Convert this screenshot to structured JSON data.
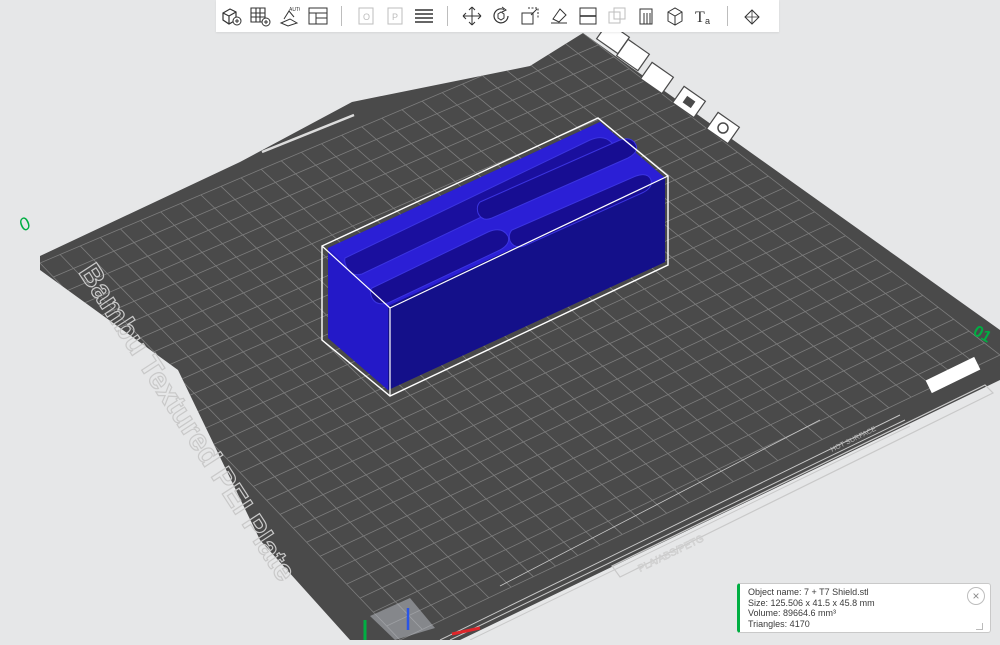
{
  "toolbar": {
    "buttons": [
      {
        "name": "add-object-icon"
      },
      {
        "name": "add-plate-icon"
      },
      {
        "name": "auto-orient-icon"
      },
      {
        "name": "arrange-icon"
      },
      {
        "name": "split-objects-icon"
      },
      {
        "name": "split-parts-icon"
      },
      {
        "name": "layers-icon"
      },
      {
        "name": "move-icon"
      },
      {
        "name": "rotate-icon"
      },
      {
        "name": "scale-icon"
      },
      {
        "name": "lay-on-face-icon"
      },
      {
        "name": "cut-icon"
      },
      {
        "name": "boolean-icon"
      },
      {
        "name": "support-paint-icon"
      },
      {
        "name": "seam-paint-icon"
      },
      {
        "name": "text-icon"
      },
      {
        "name": "measure-icon"
      }
    ]
  },
  "plate": {
    "label": "Bambu Textured PEI Plate",
    "filament_tag": "PLA/ABS/PETG",
    "hot_surface": "HOT SURFACE",
    "origin_mark": "0",
    "corner_mark": "01"
  },
  "plate_tools": [
    {
      "name": "plate-edit-icon"
    },
    {
      "name": "plate-arrange-icon"
    },
    {
      "name": "plate-orient-icon"
    },
    {
      "name": "plate-lock-icon"
    },
    {
      "name": "plate-settings-icon"
    }
  ],
  "object_info": {
    "name_line": "Object name: 7 + T7 Shield.stl",
    "size_line": "Size: 125.506 x 41.5 x 45.8 mm",
    "volume_line": "Volume: 89664.6 mm³",
    "triangles_line": "Triangles: 4170"
  },
  "colors": {
    "background": "#e6e7e8",
    "plate": "#4a4a4a",
    "grid": "#8e8e8e",
    "object": "#1e17b8",
    "accent": "#00ae42"
  }
}
